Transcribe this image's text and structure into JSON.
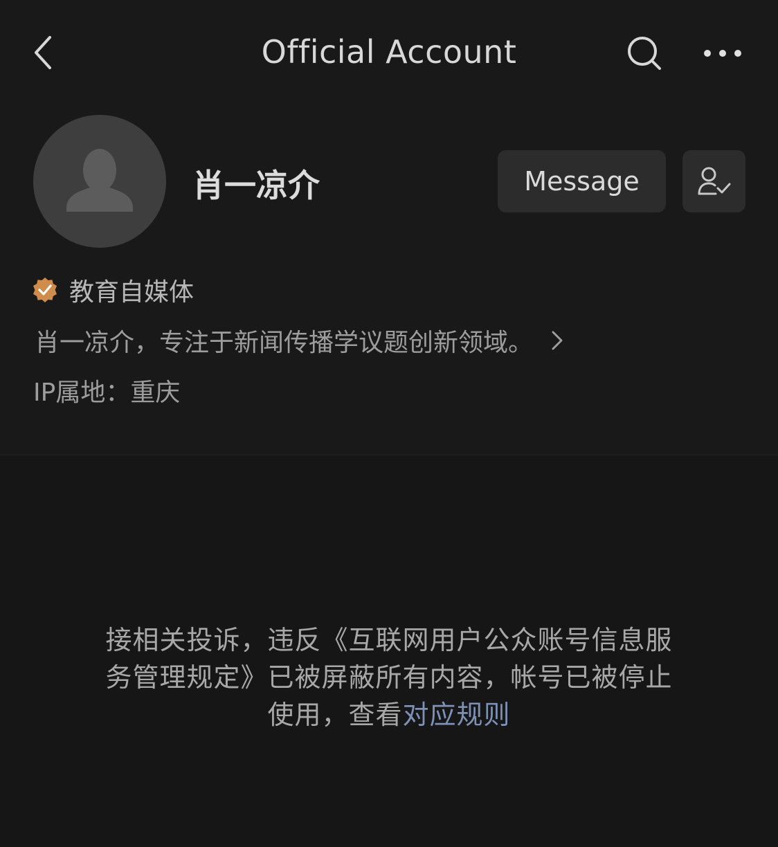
{
  "header": {
    "title": "Official Account",
    "back_icon": "chevron-left-icon",
    "search_icon": "search-icon",
    "more_icon": "more-horizontal-icon"
  },
  "profile": {
    "avatar_icon": "default-user-avatar-icon",
    "name": "肖一凉介",
    "message_label": "Message",
    "follow_icon": "followed-user-check-icon",
    "verification": {
      "badge_icon": "verified-badge-icon",
      "badge_color": "#d08c4b",
      "label": "教育自媒体"
    },
    "description": "肖一凉介，专注于新闻传播学议题创新领域。",
    "ip_location": "IP属地：重庆"
  },
  "notice": {
    "text": "接相关投诉，违反《互联网用户公众账号信息服务管理规定》已被屏蔽所有内容，帐号已被停止使用，查看",
    "link_label": "对应规则",
    "link_color": "#7d90b5"
  },
  "colors": {
    "background": "#191919",
    "button_bg": "#2c2c2c"
  }
}
